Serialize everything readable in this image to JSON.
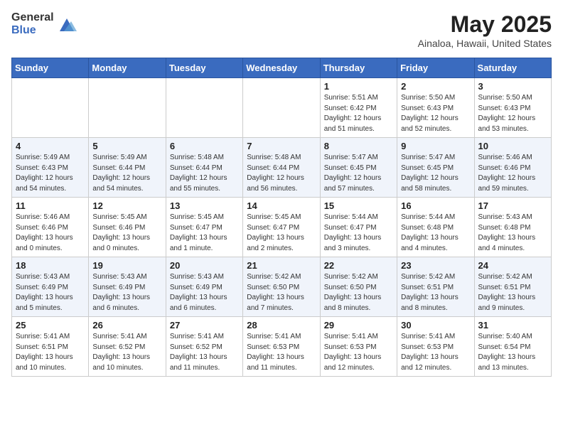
{
  "header": {
    "logo_general": "General",
    "logo_blue": "Blue",
    "month_title": "May 2025",
    "location": "Ainaloa, Hawaii, United States"
  },
  "weekdays": [
    "Sunday",
    "Monday",
    "Tuesday",
    "Wednesday",
    "Thursday",
    "Friday",
    "Saturday"
  ],
  "weeks": [
    [
      {
        "day": "",
        "sunrise": "",
        "sunset": "",
        "daylight": ""
      },
      {
        "day": "",
        "sunrise": "",
        "sunset": "",
        "daylight": ""
      },
      {
        "day": "",
        "sunrise": "",
        "sunset": "",
        "daylight": ""
      },
      {
        "day": "",
        "sunrise": "",
        "sunset": "",
        "daylight": ""
      },
      {
        "day": "1",
        "sunrise": "Sunrise: 5:51 AM",
        "sunset": "Sunset: 6:42 PM",
        "daylight": "Daylight: 12 hours and 51 minutes."
      },
      {
        "day": "2",
        "sunrise": "Sunrise: 5:50 AM",
        "sunset": "Sunset: 6:43 PM",
        "daylight": "Daylight: 12 hours and 52 minutes."
      },
      {
        "day": "3",
        "sunrise": "Sunrise: 5:50 AM",
        "sunset": "Sunset: 6:43 PM",
        "daylight": "Daylight: 12 hours and 53 minutes."
      }
    ],
    [
      {
        "day": "4",
        "sunrise": "Sunrise: 5:49 AM",
        "sunset": "Sunset: 6:43 PM",
        "daylight": "Daylight: 12 hours and 54 minutes."
      },
      {
        "day": "5",
        "sunrise": "Sunrise: 5:49 AM",
        "sunset": "Sunset: 6:44 PM",
        "daylight": "Daylight: 12 hours and 54 minutes."
      },
      {
        "day": "6",
        "sunrise": "Sunrise: 5:48 AM",
        "sunset": "Sunset: 6:44 PM",
        "daylight": "Daylight: 12 hours and 55 minutes."
      },
      {
        "day": "7",
        "sunrise": "Sunrise: 5:48 AM",
        "sunset": "Sunset: 6:44 PM",
        "daylight": "Daylight: 12 hours and 56 minutes."
      },
      {
        "day": "8",
        "sunrise": "Sunrise: 5:47 AM",
        "sunset": "Sunset: 6:45 PM",
        "daylight": "Daylight: 12 hours and 57 minutes."
      },
      {
        "day": "9",
        "sunrise": "Sunrise: 5:47 AM",
        "sunset": "Sunset: 6:45 PM",
        "daylight": "Daylight: 12 hours and 58 minutes."
      },
      {
        "day": "10",
        "sunrise": "Sunrise: 5:46 AM",
        "sunset": "Sunset: 6:46 PM",
        "daylight": "Daylight: 12 hours and 59 minutes."
      }
    ],
    [
      {
        "day": "11",
        "sunrise": "Sunrise: 5:46 AM",
        "sunset": "Sunset: 6:46 PM",
        "daylight": "Daylight: 13 hours and 0 minutes."
      },
      {
        "day": "12",
        "sunrise": "Sunrise: 5:45 AM",
        "sunset": "Sunset: 6:46 PM",
        "daylight": "Daylight: 13 hours and 0 minutes."
      },
      {
        "day": "13",
        "sunrise": "Sunrise: 5:45 AM",
        "sunset": "Sunset: 6:47 PM",
        "daylight": "Daylight: 13 hours and 1 minute."
      },
      {
        "day": "14",
        "sunrise": "Sunrise: 5:45 AM",
        "sunset": "Sunset: 6:47 PM",
        "daylight": "Daylight: 13 hours and 2 minutes."
      },
      {
        "day": "15",
        "sunrise": "Sunrise: 5:44 AM",
        "sunset": "Sunset: 6:47 PM",
        "daylight": "Daylight: 13 hours and 3 minutes."
      },
      {
        "day": "16",
        "sunrise": "Sunrise: 5:44 AM",
        "sunset": "Sunset: 6:48 PM",
        "daylight": "Daylight: 13 hours and 4 minutes."
      },
      {
        "day": "17",
        "sunrise": "Sunrise: 5:43 AM",
        "sunset": "Sunset: 6:48 PM",
        "daylight": "Daylight: 13 hours and 4 minutes."
      }
    ],
    [
      {
        "day": "18",
        "sunrise": "Sunrise: 5:43 AM",
        "sunset": "Sunset: 6:49 PM",
        "daylight": "Daylight: 13 hours and 5 minutes."
      },
      {
        "day": "19",
        "sunrise": "Sunrise: 5:43 AM",
        "sunset": "Sunset: 6:49 PM",
        "daylight": "Daylight: 13 hours and 6 minutes."
      },
      {
        "day": "20",
        "sunrise": "Sunrise: 5:43 AM",
        "sunset": "Sunset: 6:49 PM",
        "daylight": "Daylight: 13 hours and 6 minutes."
      },
      {
        "day": "21",
        "sunrise": "Sunrise: 5:42 AM",
        "sunset": "Sunset: 6:50 PM",
        "daylight": "Daylight: 13 hours and 7 minutes."
      },
      {
        "day": "22",
        "sunrise": "Sunrise: 5:42 AM",
        "sunset": "Sunset: 6:50 PM",
        "daylight": "Daylight: 13 hours and 8 minutes."
      },
      {
        "day": "23",
        "sunrise": "Sunrise: 5:42 AM",
        "sunset": "Sunset: 6:51 PM",
        "daylight": "Daylight: 13 hours and 8 minutes."
      },
      {
        "day": "24",
        "sunrise": "Sunrise: 5:42 AM",
        "sunset": "Sunset: 6:51 PM",
        "daylight": "Daylight: 13 hours and 9 minutes."
      }
    ],
    [
      {
        "day": "25",
        "sunrise": "Sunrise: 5:41 AM",
        "sunset": "Sunset: 6:51 PM",
        "daylight": "Daylight: 13 hours and 10 minutes."
      },
      {
        "day": "26",
        "sunrise": "Sunrise: 5:41 AM",
        "sunset": "Sunset: 6:52 PM",
        "daylight": "Daylight: 13 hours and 10 minutes."
      },
      {
        "day": "27",
        "sunrise": "Sunrise: 5:41 AM",
        "sunset": "Sunset: 6:52 PM",
        "daylight": "Daylight: 13 hours and 11 minutes."
      },
      {
        "day": "28",
        "sunrise": "Sunrise: 5:41 AM",
        "sunset": "Sunset: 6:53 PM",
        "daylight": "Daylight: 13 hours and 11 minutes."
      },
      {
        "day": "29",
        "sunrise": "Sunrise: 5:41 AM",
        "sunset": "Sunset: 6:53 PM",
        "daylight": "Daylight: 13 hours and 12 minutes."
      },
      {
        "day": "30",
        "sunrise": "Sunrise: 5:41 AM",
        "sunset": "Sunset: 6:53 PM",
        "daylight": "Daylight: 13 hours and 12 minutes."
      },
      {
        "day": "31",
        "sunrise": "Sunrise: 5:40 AM",
        "sunset": "Sunset: 6:54 PM",
        "daylight": "Daylight: 13 hours and 13 minutes."
      }
    ]
  ]
}
